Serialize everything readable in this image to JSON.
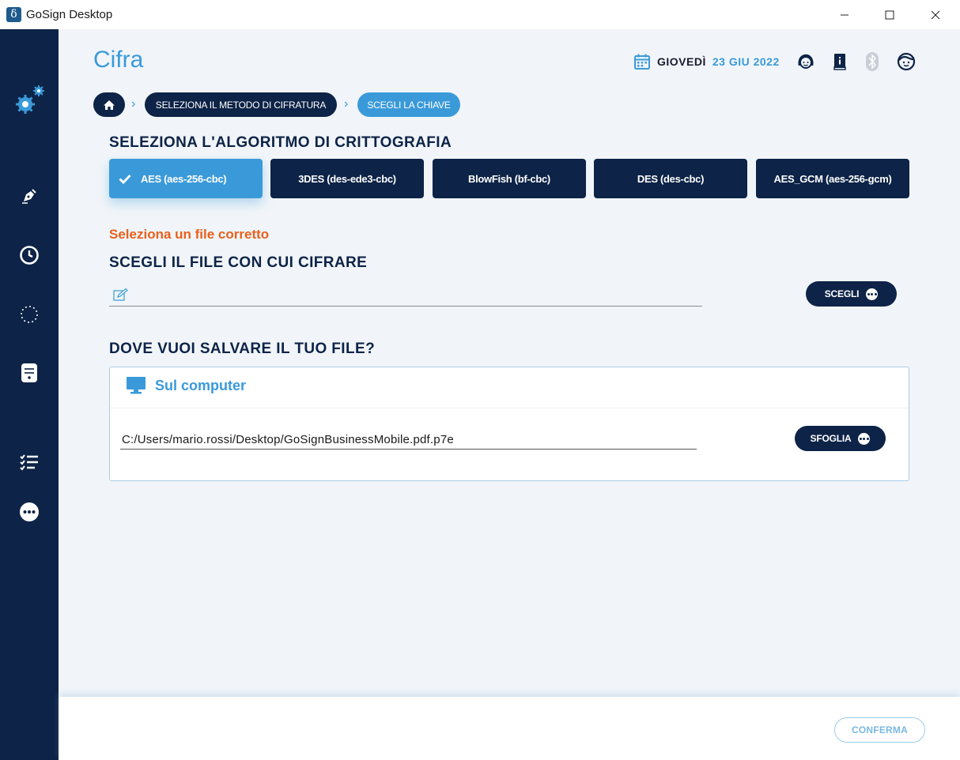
{
  "window": {
    "app_title": "GoSign Desktop",
    "logo_glyph": "δ",
    "controls": [
      "minimize-icon",
      "maximize-icon",
      "close-icon"
    ]
  },
  "sidebar": {
    "items": [
      {
        "name": "settings",
        "icon": "gears-icon"
      },
      {
        "name": "sign",
        "icon": "pen-nib-icon"
      },
      {
        "name": "history",
        "icon": "clock-icon"
      },
      {
        "name": "pending",
        "icon": "dotted-circle-icon"
      },
      {
        "name": "storage",
        "icon": "database-icon"
      },
      {
        "name": "tasks",
        "icon": "checklist-icon"
      },
      {
        "name": "more",
        "icon": "more-dots-icon"
      }
    ]
  },
  "header": {
    "title": "Cifra",
    "date_day": "GIOVEDÌ",
    "date_value": "23 GIU 2022",
    "icons": [
      "calendar-icon",
      "support-agent-icon",
      "manual-book-icon",
      "bluetooth-icon",
      "user-face-icon"
    ]
  },
  "breadcrumb": {
    "home_icon": "home-icon",
    "steps": [
      "SELEZIONA IL METODO DI CIFRATURA",
      "SCEGLI LA CHIAVE"
    ],
    "separator": "›"
  },
  "algorithm": {
    "title": "SELEZIONA L'ALGORITMO DI CRITTOGRAFIA",
    "options": [
      {
        "label": "AES (aes-256-cbc)",
        "selected": true
      },
      {
        "label": "3DES (des-ede3-cbc)",
        "selected": false
      },
      {
        "label": "BlowFish (bf-cbc)",
        "selected": false
      },
      {
        "label": "DES (des-cbc)",
        "selected": false
      },
      {
        "label": "AES_GCM (aes-256-gcm)",
        "selected": false
      }
    ]
  },
  "file": {
    "error": "Seleziona un file corretto",
    "title": "SCEGLI IL FILE CON CUI CIFRARE",
    "value": "",
    "button_label": "SCEGLI"
  },
  "save": {
    "title": "DOVE VUOI SALVARE IL TUO FILE?",
    "option_label": "Sul computer",
    "path": "C:/Users/mario.rossi/Desktop/GoSignBusinessMobile.pdf.p7e",
    "button_label": "SFOGLIA"
  },
  "footer": {
    "confirm_label": "CONFERMA"
  },
  "colors": {
    "navy": "#0d2347",
    "accent": "#3a9ad9",
    "error": "#e8601c",
    "background": "#f1f5f9"
  }
}
